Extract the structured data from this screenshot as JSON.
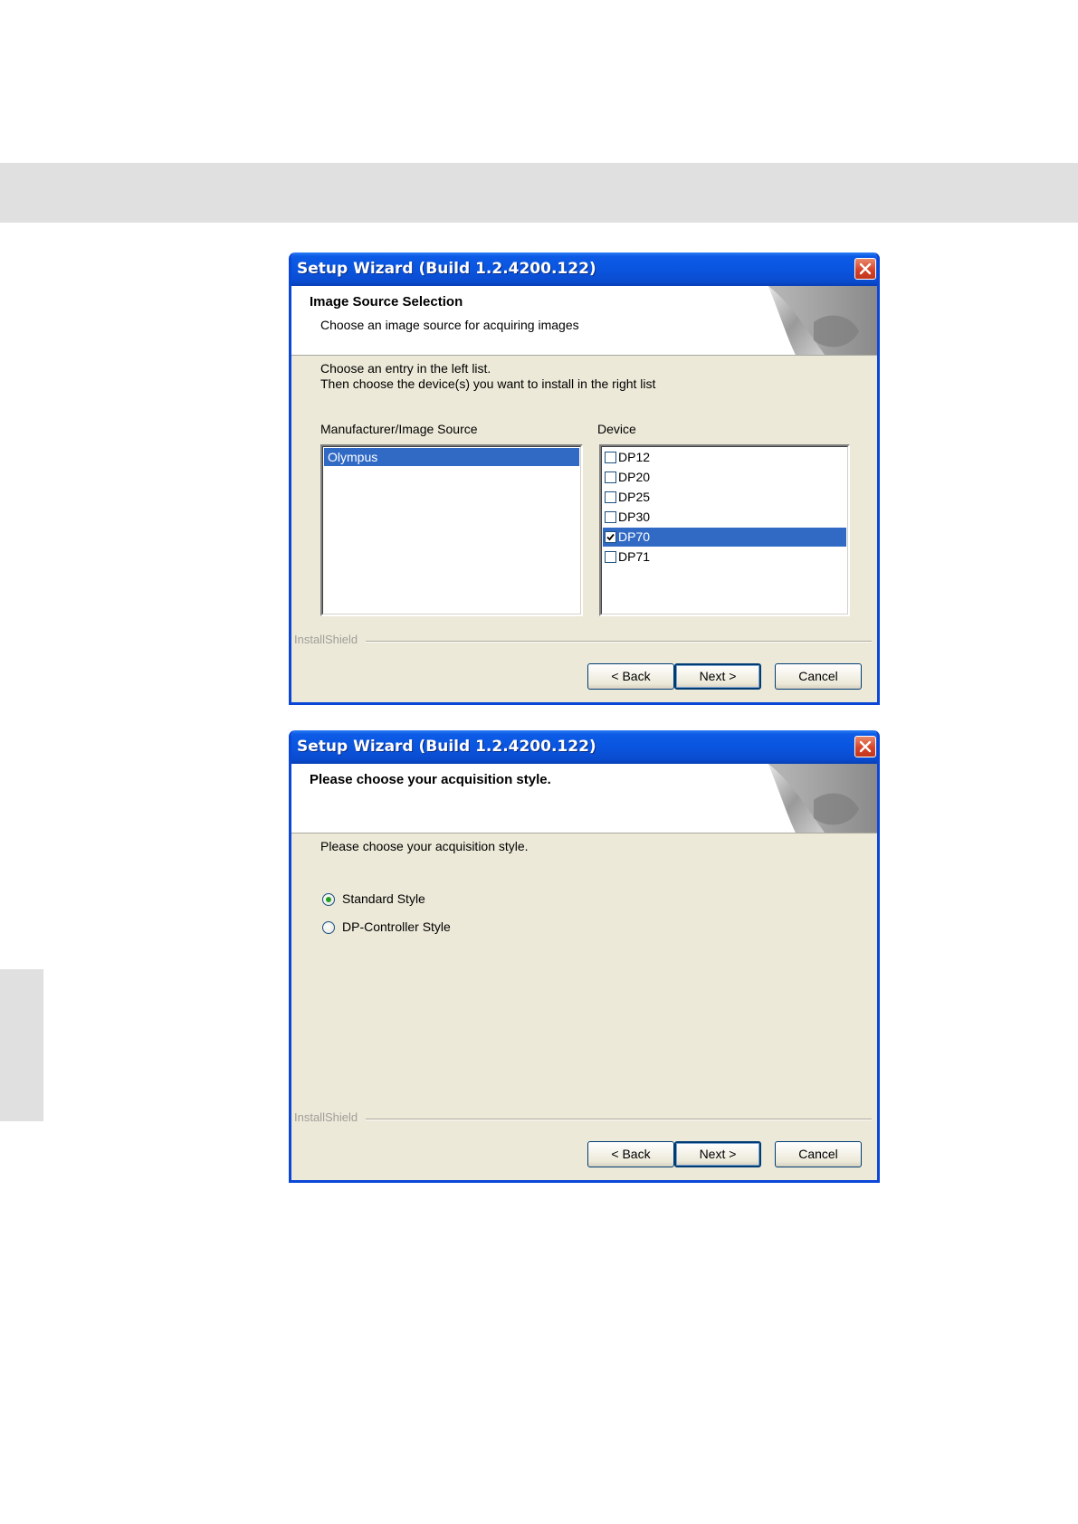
{
  "dialog1": {
    "title": "Setup Wizard (Build 1.2.4200.122)",
    "header_title": "Image Source Selection",
    "header_subtitle": "Choose an image source for acquiring images",
    "instruction_line1": "Choose an entry in the left list.",
    "instruction_line2": "Then choose the device(s) you want to install in the right list",
    "manufacturer_label": "Manufacturer/Image Source",
    "device_label": "Device",
    "manufacturers": [
      {
        "label": "Olympus",
        "selected": true
      }
    ],
    "devices": [
      {
        "label": "DP12",
        "checked": false,
        "selected": false
      },
      {
        "label": "DP20",
        "checked": false,
        "selected": false
      },
      {
        "label": "DP25",
        "checked": false,
        "selected": false
      },
      {
        "label": "DP30",
        "checked": false,
        "selected": false
      },
      {
        "label": "DP70",
        "checked": true,
        "selected": true
      },
      {
        "label": "DP71",
        "checked": false,
        "selected": false
      }
    ],
    "brand": "InstallShield",
    "back_label": "< Back",
    "next_label": "Next >",
    "cancel_label": "Cancel"
  },
  "dialog2": {
    "title": "Setup Wizard (Build 1.2.4200.122)",
    "header_title": "Please choose your acquisition style.",
    "instruction": "Please choose your acquisition style.",
    "options": [
      {
        "label": "Standard Style",
        "selected": true
      },
      {
        "label": "DP-Controller Style",
        "selected": false
      }
    ],
    "brand": "InstallShield",
    "back_label": "< Back",
    "next_label": "Next >",
    "cancel_label": "Cancel"
  },
  "icons": {
    "close": "close-icon",
    "header_art": "page-curl-art",
    "check": "checkmark-icon"
  },
  "colors": {
    "titlebar": "#0a55df",
    "selection": "#316ac5",
    "dialog_bg": "#ece9d8",
    "close": "#d6442a"
  }
}
